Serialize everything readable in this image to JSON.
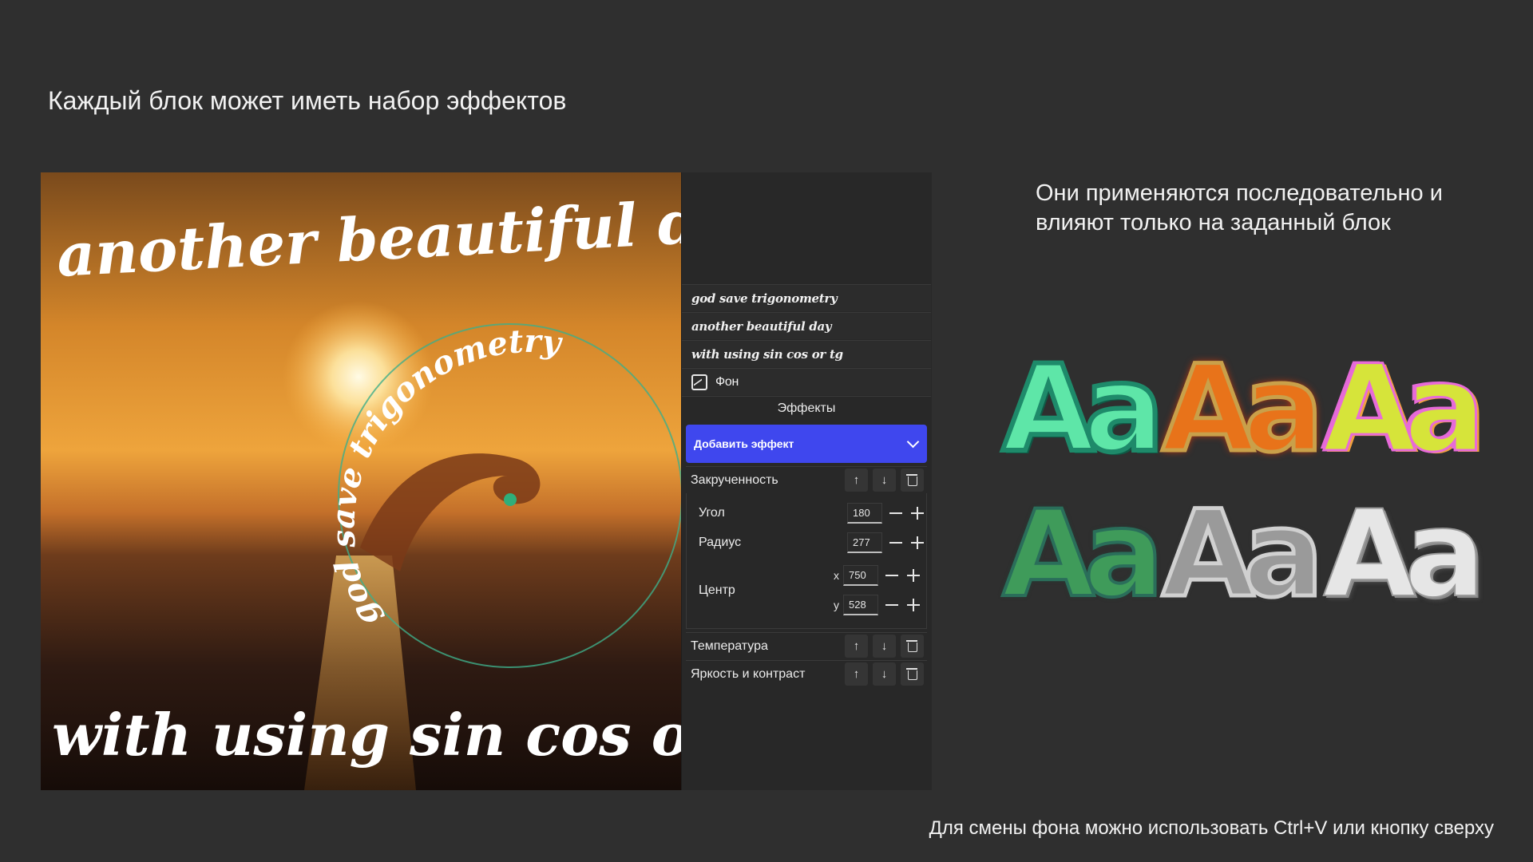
{
  "slide": {
    "title": "Каждый блок может иметь набор эффектов",
    "side_text": "Они применяются последовательно и влияют только на заданный блок",
    "footer": "Для смены фона можно использовать Ctrl+V или кнопку сверху"
  },
  "canvas": {
    "top_text": "another beautiful day",
    "circle_text": "god save trigonometry",
    "bottom_text": "with using sin cos or tg"
  },
  "layers": [
    {
      "label": "god save trigonometry"
    },
    {
      "label": "another beautiful day"
    },
    {
      "label": "with using sin cos or tg"
    },
    {
      "label": "Фон",
      "icon": "image-icon"
    }
  ],
  "effects_panel": {
    "header": "Эффекты",
    "add_effect_label": "Добавить эффект",
    "effects": [
      {
        "name": "Закрученность"
      },
      {
        "name": "Температура"
      },
      {
        "name": "Яркость и контраст"
      }
    ],
    "twirl_params": {
      "angle_label": "Угол",
      "angle_value": "180",
      "radius_label": "Радиус",
      "radius_value": "277",
      "center_label": "Центр",
      "center_x_label": "x",
      "center_x": "750",
      "center_y_label": "y",
      "center_y": "528"
    }
  },
  "samples": {
    "text": "Aa",
    "styles": [
      {
        "name": "mint-outline",
        "color": "#5ee6a8"
      },
      {
        "name": "fire-gold",
        "color": "#e8731a"
      },
      {
        "name": "rainbow-twirl",
        "color": "#d6e43a"
      },
      {
        "name": "green-texture",
        "color": "#3f9b5a"
      },
      {
        "name": "silver-sequin",
        "color": "#a8a8a8"
      },
      {
        "name": "white-3d",
        "color": "#e6e6e6"
      }
    ]
  },
  "colors": {
    "accent": "#3f47ee",
    "background": "#2f2f2f",
    "panel": "#282828"
  }
}
